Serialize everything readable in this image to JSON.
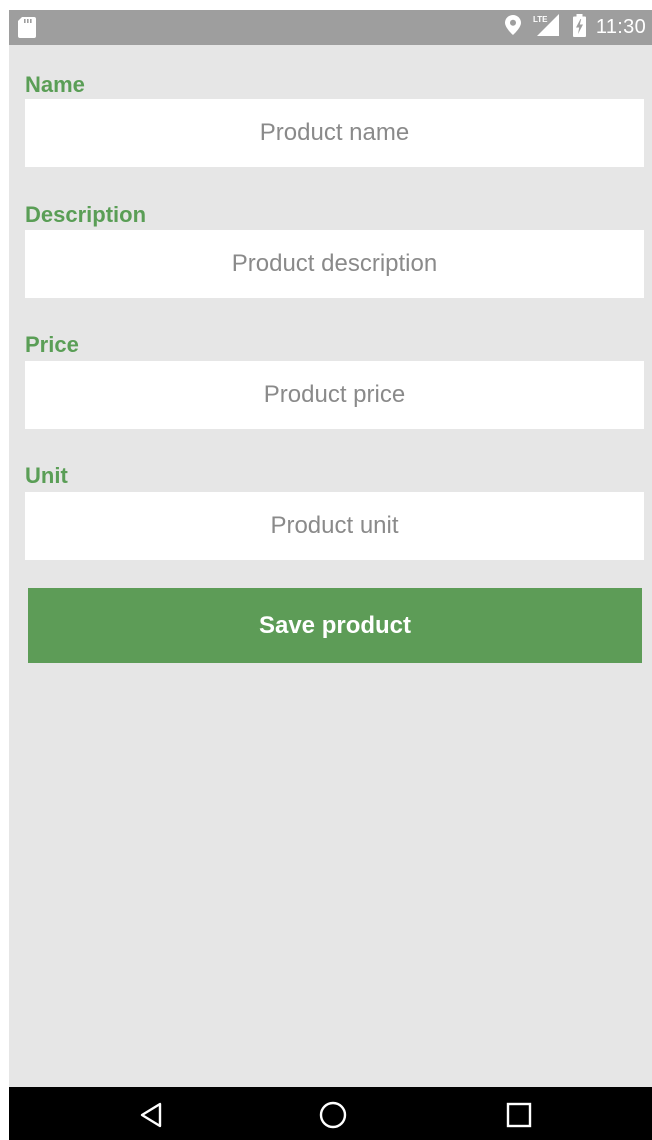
{
  "status_bar": {
    "time": "11:30",
    "network_label": "LTE",
    "icons": [
      "sd-card-icon",
      "location-pin-icon",
      "lte-signal-icon",
      "battery-charging-icon"
    ]
  },
  "form": {
    "fields": [
      {
        "label": "Name",
        "placeholder": "Product name",
        "value": ""
      },
      {
        "label": "Description",
        "placeholder": "Product description",
        "value": ""
      },
      {
        "label": "Price",
        "placeholder": "Product price",
        "value": ""
      },
      {
        "label": "Unit",
        "placeholder": "Product unit",
        "value": ""
      }
    ],
    "save_label": "Save product"
  },
  "nav_bar": {
    "icons": [
      "back-icon",
      "home-icon",
      "recents-icon"
    ]
  },
  "colors": {
    "accent": "#5d9c57",
    "label": "#5a9e56",
    "background": "#e6e6e6",
    "status_bar": "#9e9e9e",
    "nav_bar": "#000000"
  }
}
